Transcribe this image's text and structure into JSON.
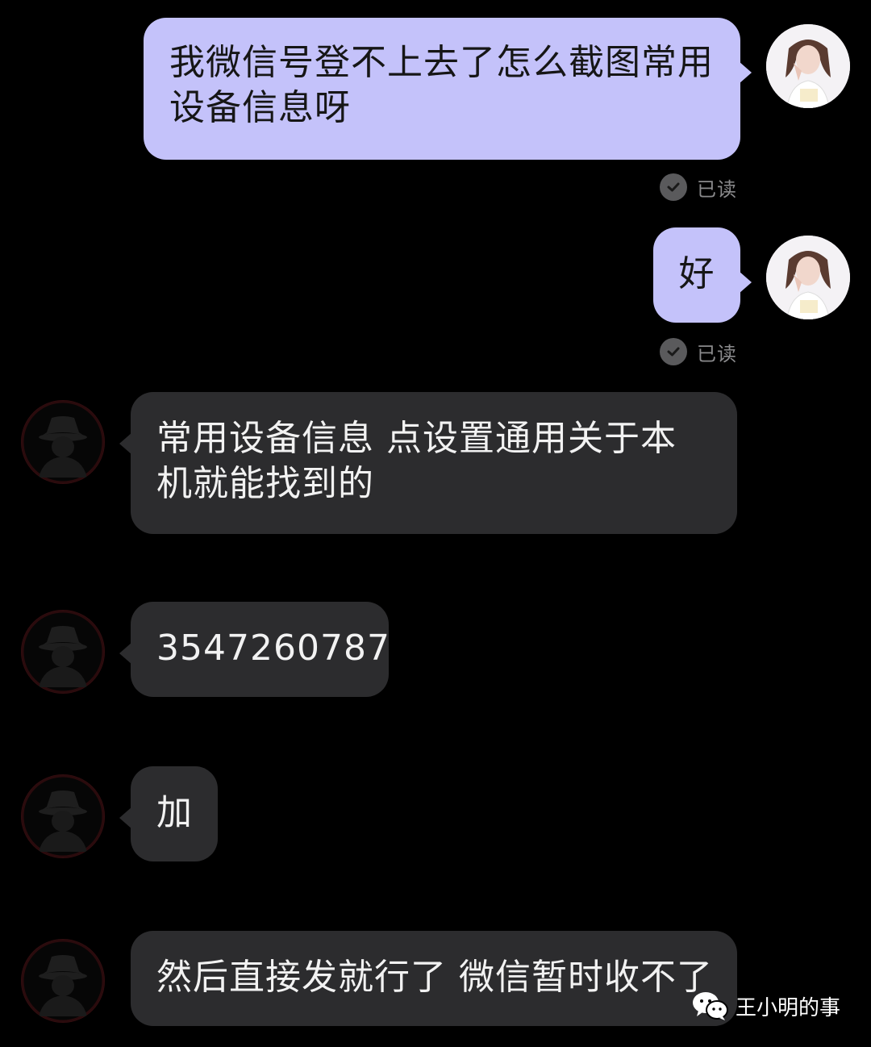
{
  "messages": [
    {
      "from": "self",
      "text": "我微信号登不上去了怎么截图常用设备信息呀",
      "status": "已读"
    },
    {
      "from": "self",
      "text": "好",
      "status": "已读"
    },
    {
      "from": "other",
      "text": "常用设备信息 点设置通用关于本机就能找到的"
    },
    {
      "from": "other",
      "text": "3547260787"
    },
    {
      "from": "other",
      "text": "加"
    },
    {
      "from": "other",
      "text": "然后直接发就行了 微信暂时收不了"
    }
  ],
  "watermark": {
    "text": "王小明的事",
    "icon": "wechat-icon"
  },
  "colors": {
    "background": "#000000",
    "outgoing_bubble": "#c4c2fa",
    "incoming_bubble": "#2c2c2e",
    "read_status": "#8a8a8c"
  },
  "icons": {
    "self_avatar": "girl-photo-avatar",
    "other_avatar": "hat-silhouette-avatar",
    "read_check": "check-circle-icon"
  }
}
